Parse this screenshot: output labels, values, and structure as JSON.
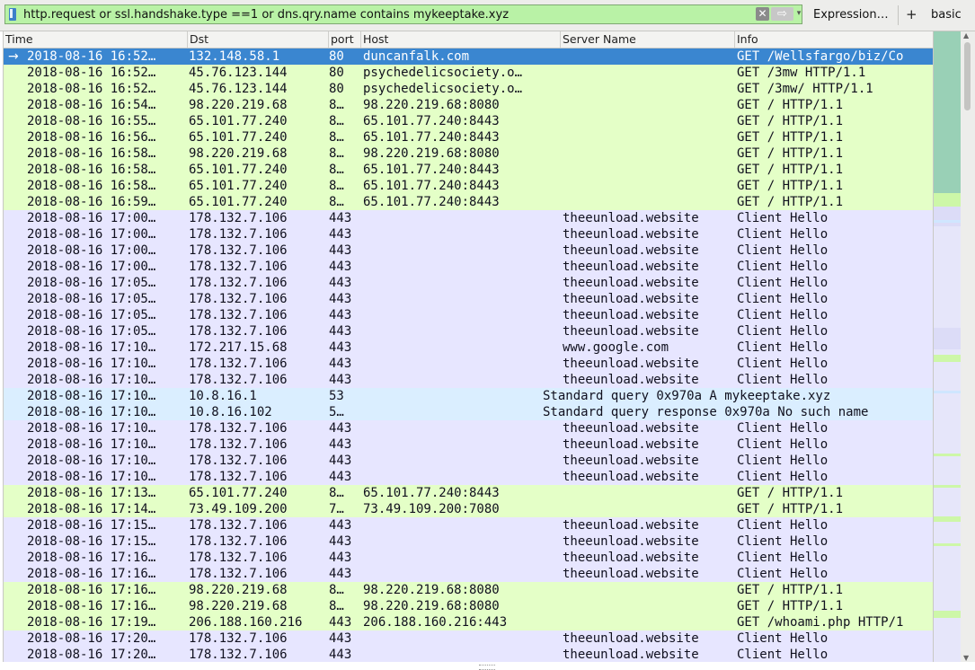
{
  "toolbar": {
    "filter_value": "http.request or ssl.handshake.type ==1 or dns.qry.name contains mykeeptake.xyz",
    "clear_icon": "✕",
    "apply_icon": "⇨",
    "dropdown_icon": "▾",
    "expression_label": "Expression…",
    "add_label": "+",
    "basic_label": "basic",
    "filter_bg": "#b9f2a6"
  },
  "columns": {
    "time": "Time",
    "dst": "Dst",
    "port": "port",
    "host": "Host",
    "server": "Server Name",
    "info": "Info"
  },
  "colors": {
    "http": "#e4ffc7",
    "tls": "#e7e6ff",
    "dns": "#daeeff",
    "selected": "#3a86d0"
  },
  "packets": [
    {
      "time": "2018-08-16 16:52…",
      "dst": "132.148.58.1",
      "port": "80",
      "host": "duncanfalk.com",
      "server": "",
      "info": "GET /Wellsfargo/biz/Co",
      "kind": "http",
      "selected": true
    },
    {
      "time": "2018-08-16 16:52…",
      "dst": "45.76.123.144",
      "port": "80",
      "host": "psychedelicsociety.o…",
      "server": "",
      "info": "GET /3mw HTTP/1.1",
      "kind": "http"
    },
    {
      "time": "2018-08-16 16:52…",
      "dst": "45.76.123.144",
      "port": "80",
      "host": "psychedelicsociety.o…",
      "server": "",
      "info": "GET /3mw/ HTTP/1.1",
      "kind": "http"
    },
    {
      "time": "2018-08-16 16:54…",
      "dst": "98.220.219.68",
      "port": "8…",
      "host": "98.220.219.68:8080",
      "server": "",
      "info": "GET / HTTP/1.1",
      "kind": "http"
    },
    {
      "time": "2018-08-16 16:55…",
      "dst": "65.101.77.240",
      "port": "8…",
      "host": "65.101.77.240:8443",
      "server": "",
      "info": "GET / HTTP/1.1",
      "kind": "http"
    },
    {
      "time": "2018-08-16 16:56…",
      "dst": "65.101.77.240",
      "port": "8…",
      "host": "65.101.77.240:8443",
      "server": "",
      "info": "GET / HTTP/1.1",
      "kind": "http"
    },
    {
      "time": "2018-08-16 16:58…",
      "dst": "98.220.219.68",
      "port": "8…",
      "host": "98.220.219.68:8080",
      "server": "",
      "info": "GET / HTTP/1.1",
      "kind": "http"
    },
    {
      "time": "2018-08-16 16:58…",
      "dst": "65.101.77.240",
      "port": "8…",
      "host": "65.101.77.240:8443",
      "server": "",
      "info": "GET / HTTP/1.1",
      "kind": "http"
    },
    {
      "time": "2018-08-16 16:58…",
      "dst": "65.101.77.240",
      "port": "8…",
      "host": "65.101.77.240:8443",
      "server": "",
      "info": "GET / HTTP/1.1",
      "kind": "http"
    },
    {
      "time": "2018-08-16 16:59…",
      "dst": "65.101.77.240",
      "port": "8…",
      "host": "65.101.77.240:8443",
      "server": "",
      "info": "GET / HTTP/1.1",
      "kind": "http"
    },
    {
      "time": "2018-08-16 17:00…",
      "dst": "178.132.7.106",
      "port": "443",
      "host": "",
      "server": "theeunload.website",
      "info": "Client Hello",
      "kind": "tls"
    },
    {
      "time": "2018-08-16 17:00…",
      "dst": "178.132.7.106",
      "port": "443",
      "host": "",
      "server": "theeunload.website",
      "info": "Client Hello",
      "kind": "tls"
    },
    {
      "time": "2018-08-16 17:00…",
      "dst": "178.132.7.106",
      "port": "443",
      "host": "",
      "server": "theeunload.website",
      "info": "Client Hello",
      "kind": "tls"
    },
    {
      "time": "2018-08-16 17:00…",
      "dst": "178.132.7.106",
      "port": "443",
      "host": "",
      "server": "theeunload.website",
      "info": "Client Hello",
      "kind": "tls"
    },
    {
      "time": "2018-08-16 17:05…",
      "dst": "178.132.7.106",
      "port": "443",
      "host": "",
      "server": "theeunload.website",
      "info": "Client Hello",
      "kind": "tls"
    },
    {
      "time": "2018-08-16 17:05…",
      "dst": "178.132.7.106",
      "port": "443",
      "host": "",
      "server": "theeunload.website",
      "info": "Client Hello",
      "kind": "tls"
    },
    {
      "time": "2018-08-16 17:05…",
      "dst": "178.132.7.106",
      "port": "443",
      "host": "",
      "server": "theeunload.website",
      "info": "Client Hello",
      "kind": "tls"
    },
    {
      "time": "2018-08-16 17:05…",
      "dst": "178.132.7.106",
      "port": "443",
      "host": "",
      "server": "theeunload.website",
      "info": "Client Hello",
      "kind": "tls"
    },
    {
      "time": "2018-08-16 17:10…",
      "dst": "172.217.15.68",
      "port": "443",
      "host": "",
      "server": "www.google.com",
      "info": "Client Hello",
      "kind": "tls"
    },
    {
      "time": "2018-08-16 17:10…",
      "dst": "178.132.7.106",
      "port": "443",
      "host": "",
      "server": "theeunload.website",
      "info": "Client Hello",
      "kind": "tls"
    },
    {
      "time": "2018-08-16 17:10…",
      "dst": "178.132.7.106",
      "port": "443",
      "host": "",
      "server": "theeunload.website",
      "info": "Client Hello",
      "kind": "tls"
    },
    {
      "time": "2018-08-16 17:10…",
      "dst": "10.8.16.1",
      "port": "53",
      "host": "",
      "server": "",
      "info": "Standard query 0x970a A mykeeptake.xyz",
      "kind": "dns"
    },
    {
      "time": "2018-08-16 17:10…",
      "dst": "10.8.16.102",
      "port": "5…",
      "host": "",
      "server": "",
      "info": "Standard query response 0x970a No such name",
      "kind": "dns"
    },
    {
      "time": "2018-08-16 17:10…",
      "dst": "178.132.7.106",
      "port": "443",
      "host": "",
      "server": "theeunload.website",
      "info": "Client Hello",
      "kind": "tls"
    },
    {
      "time": "2018-08-16 17:10…",
      "dst": "178.132.7.106",
      "port": "443",
      "host": "",
      "server": "theeunload.website",
      "info": "Client Hello",
      "kind": "tls"
    },
    {
      "time": "2018-08-16 17:10…",
      "dst": "178.132.7.106",
      "port": "443",
      "host": "",
      "server": "theeunload.website",
      "info": "Client Hello",
      "kind": "tls"
    },
    {
      "time": "2018-08-16 17:10…",
      "dst": "178.132.7.106",
      "port": "443",
      "host": "",
      "server": "theeunload.website",
      "info": "Client Hello",
      "kind": "tls"
    },
    {
      "time": "2018-08-16 17:13…",
      "dst": "65.101.77.240",
      "port": "8…",
      "host": "65.101.77.240:8443",
      "server": "",
      "info": "GET / HTTP/1.1",
      "kind": "http"
    },
    {
      "time": "2018-08-16 17:14…",
      "dst": "73.49.109.200",
      "port": "7…",
      "host": "73.49.109.200:7080",
      "server": "",
      "info": "GET / HTTP/1.1",
      "kind": "http"
    },
    {
      "time": "2018-08-16 17:15…",
      "dst": "178.132.7.106",
      "port": "443",
      "host": "",
      "server": "theeunload.website",
      "info": "Client Hello",
      "kind": "tls"
    },
    {
      "time": "2018-08-16 17:15…",
      "dst": "178.132.7.106",
      "port": "443",
      "host": "",
      "server": "theeunload.website",
      "info": "Client Hello",
      "kind": "tls"
    },
    {
      "time": "2018-08-16 17:16…",
      "dst": "178.132.7.106",
      "port": "443",
      "host": "",
      "server": "theeunload.website",
      "info": "Client Hello",
      "kind": "tls"
    },
    {
      "time": "2018-08-16 17:16…",
      "dst": "178.132.7.106",
      "port": "443",
      "host": "",
      "server": "theeunload.website",
      "info": "Client Hello",
      "kind": "tls"
    },
    {
      "time": "2018-08-16 17:16…",
      "dst": "98.220.219.68",
      "port": "8…",
      "host": "98.220.219.68:8080",
      "server": "",
      "info": "GET / HTTP/1.1",
      "kind": "http"
    },
    {
      "time": "2018-08-16 17:16…",
      "dst": "98.220.219.68",
      "port": "8…",
      "host": "98.220.219.68:8080",
      "server": "",
      "info": "GET / HTTP/1.1",
      "kind": "http"
    },
    {
      "time": "2018-08-16 17:19…",
      "dst": "206.188.160.216",
      "port": "443",
      "host": "206.188.160.216:443",
      "server": "",
      "info": "GET /whoami.php HTTP/1",
      "kind": "http"
    },
    {
      "time": "2018-08-16 17:20…",
      "dst": "178.132.7.106",
      "port": "443",
      "host": "",
      "server": "theeunload.website",
      "info": "Client Hello",
      "kind": "tls"
    },
    {
      "time": "2018-08-16 17:20…",
      "dst": "178.132.7.106",
      "port": "443",
      "host": "",
      "server": "theeunload.website",
      "info": "Client Hello",
      "kind": "tls"
    }
  ]
}
